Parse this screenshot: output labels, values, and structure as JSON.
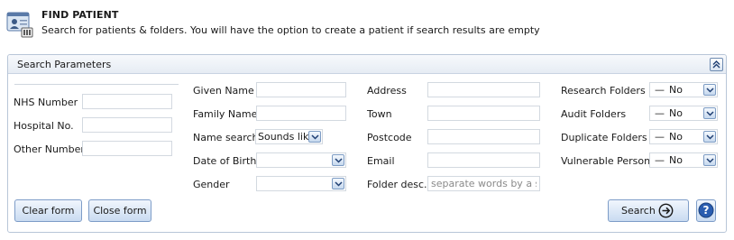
{
  "header": {
    "title": "FIND PATIENT",
    "subtitle": "Search for patients & folders. You will have the option to create a patient if search results are empty",
    "icon": "patient-folder-icon"
  },
  "panel": {
    "title": "Search Parameters",
    "collapse_icon": "double-chevron-up-icon"
  },
  "fields": {
    "nhs_number": {
      "label": "NHS Number",
      "value": ""
    },
    "hospital_no": {
      "label": "Hospital No.",
      "value": ""
    },
    "other_number": {
      "label": "Other Number",
      "value": ""
    },
    "given_name": {
      "label": "Given Name",
      "value": ""
    },
    "family_name": {
      "label": "Family Name",
      "value": ""
    },
    "name_search": {
      "label": "Name search",
      "value": "Sounds like"
    },
    "date_of_birth": {
      "label": "Date of Birth",
      "value": ""
    },
    "gender": {
      "label": "Gender",
      "value": ""
    },
    "address": {
      "label": "Address",
      "value": ""
    },
    "town": {
      "label": "Town",
      "value": ""
    },
    "postcode": {
      "label": "Postcode",
      "value": ""
    },
    "email": {
      "label": "Email",
      "value": ""
    },
    "folder_desc": {
      "label": "Folder desc.",
      "value": "",
      "placeholder": "separate words by a space"
    }
  },
  "folders": {
    "research": {
      "label": "Research Folders",
      "dash": "—",
      "value": "No"
    },
    "audit": {
      "label": "Audit Folders",
      "dash": "—",
      "value": "No"
    },
    "duplicate": {
      "label": "Duplicate Folders",
      "dash": "—",
      "value": "No"
    },
    "vulnerable": {
      "label": "Vulnerable Persons",
      "dash": "—",
      "value": "No"
    }
  },
  "buttons": {
    "clear_form": "Clear form",
    "close_form": "Close form",
    "search": "Search",
    "help_icon": "help-icon",
    "search_icon": "arrow-right-circle-icon"
  },
  "colors": {
    "panel_border": "#b8c6d8",
    "button_border": "#7e9dc8",
    "help_blue": "#2a5db0",
    "field_border": "#d3d9e0"
  }
}
